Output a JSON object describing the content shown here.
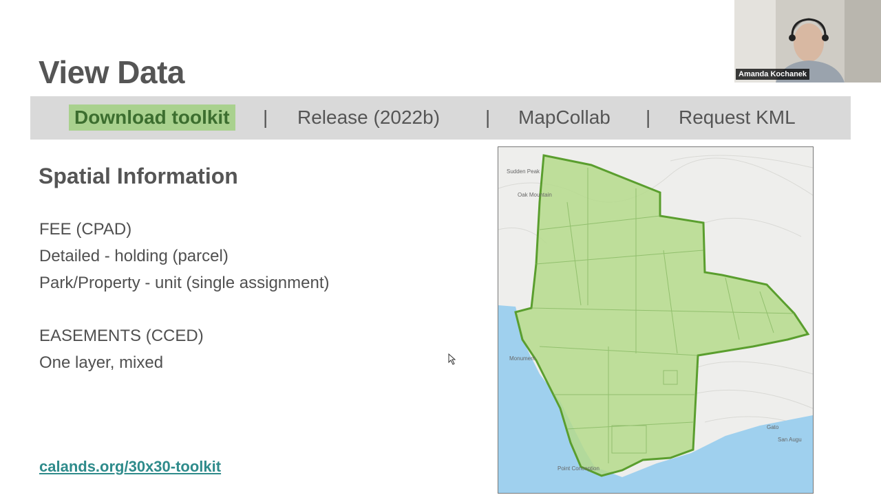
{
  "slide": {
    "title": "View Data",
    "subtitle": "Spatial Information",
    "lines": [
      "FEE (CPAD)",
      "Detailed - holding (parcel)",
      "Park/Property - unit (single assignment)",
      "EASEMENTS (CCED)",
      "One layer, mixed"
    ],
    "link": "calands.org/30x30-toolkit"
  },
  "nav": {
    "items": [
      "Download toolkit",
      "Release (2022b)",
      "MapCollab",
      "Request KML"
    ],
    "separator": "|",
    "active_index": 0,
    "active_color": "#a9d18e"
  },
  "map": {
    "labels": {
      "sudden_peak": "Sudden Peak",
      "oak_mountain": "Oak Mountain",
      "point_conception": "Point Conception",
      "gato": "Gato",
      "san_augustine": "San Augu",
      "monument": "Monument"
    },
    "land_color": "#eeeeec",
    "water_color": "#9fd0ee",
    "region_color": "#b5da8c"
  },
  "video": {
    "participant_name": "Amanda Kochanek"
  }
}
